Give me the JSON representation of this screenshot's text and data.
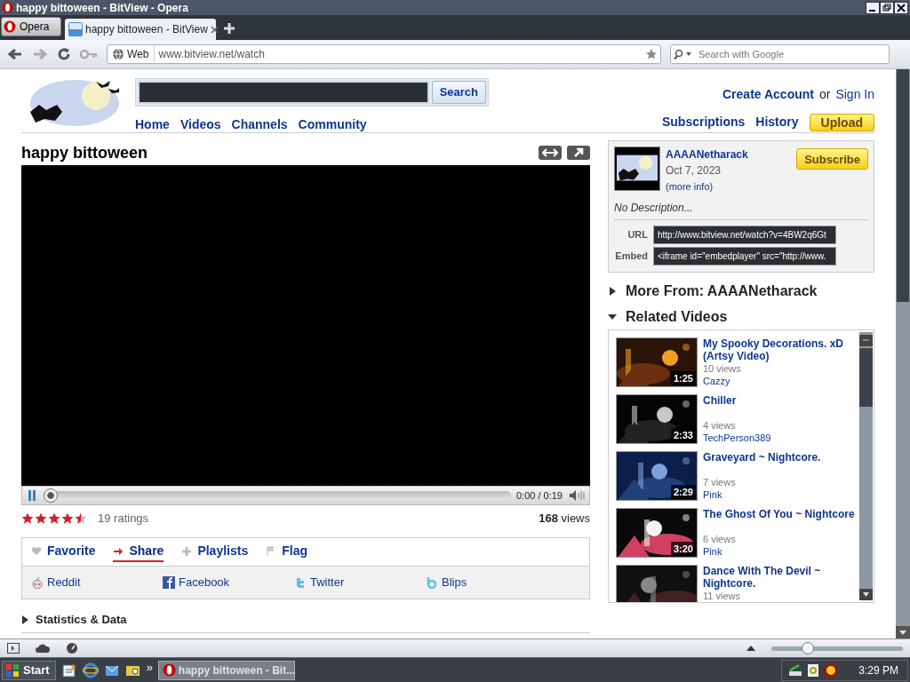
{
  "browser": {
    "title": "happy bittoween - BitView - Opera",
    "menu_button": "Opera",
    "tabs": [
      {
        "label": "happy bittoween - BitView",
        "selected": true
      }
    ],
    "address_badge": "Web",
    "url": "www.bitview.net/watch",
    "search_placeholder": "Search with Google"
  },
  "site": {
    "search_button": "Search",
    "nav": [
      "Home",
      "Videos",
      "Channels",
      "Community"
    ],
    "create_account": "Create Account",
    "or": "or",
    "sign_in": "Sign In",
    "user_links": [
      "Subscriptions",
      "History"
    ],
    "upload": "Upload"
  },
  "video": {
    "title": "happy bittoween",
    "progress": {
      "level": 0
    },
    "time": "0:00 / 0:19",
    "stars": 4.5,
    "ratings": "19 ratings",
    "views_count": "168",
    "views_label": "views",
    "actions": [
      {
        "label": "Favorite",
        "selected": false
      },
      {
        "label": "Share",
        "selected": true
      },
      {
        "label": "Playlists",
        "selected": false
      },
      {
        "label": "Flag",
        "selected": false
      }
    ],
    "share_links": [
      "Reddit",
      "Facebook",
      "Twitter",
      "Blips"
    ],
    "statistics": {
      "label": "Statistics & Data",
      "expanded": false
    }
  },
  "uploader": {
    "name": "AAAANetharack",
    "date": "Oct 7, 2023",
    "more_info": "(more info)",
    "subscribe": "Subscribe",
    "description": "No Description...",
    "url_label": "URL",
    "url": "http://www.bitview.net/watch?v=4BW2q6Gt",
    "embed_label": "Embed",
    "embed": "<iframe id=\"embedplayer\" src=\"http://www."
  },
  "sections": [
    {
      "label": "More From: AAAANetharack",
      "expanded": false
    },
    {
      "label": "Related Videos",
      "expanded": true
    }
  ],
  "related": [
    {
      "title": "My Spooky Decorations. xD (Artsy Video)",
      "views": "10 views",
      "author": "Cazzy",
      "duration": "1:25"
    },
    {
      "title": "Chiller",
      "views": "4 views",
      "author": "TechPerson389",
      "duration": "2:33"
    },
    {
      "title": "Graveyard ~ Nightcore.",
      "views": "7 views",
      "author": "Pink",
      "duration": "2:29"
    },
    {
      "title": "The Ghost Of You ~ Nightcore",
      "views": "6 views",
      "author": "Pink",
      "duration": "3:20"
    },
    {
      "title": "Dance With The Devil ~ Nightcore.",
      "views": "11 views"
    }
  ],
  "status_bar": {
    "zoom": {
      "level": 0.28
    }
  },
  "taskbar": {
    "start": "Start",
    "more": "»",
    "task": "happy bittoween - Bit...",
    "clock": "3:29 PM"
  }
}
